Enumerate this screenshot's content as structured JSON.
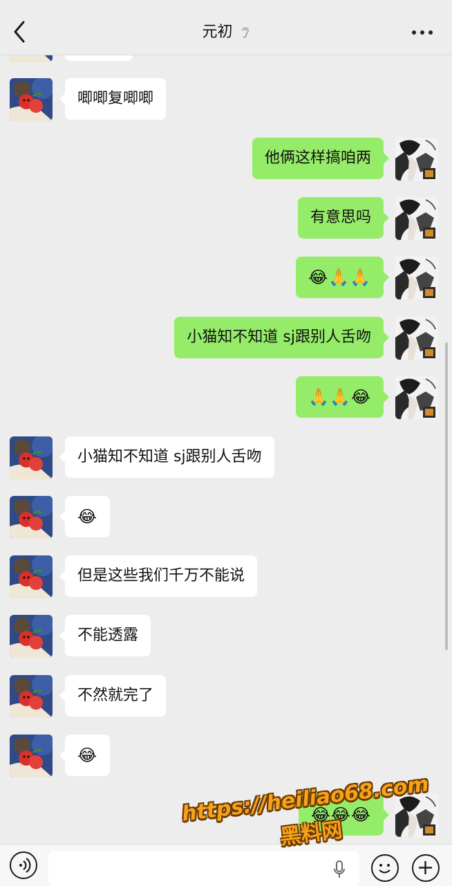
{
  "header": {
    "title": "元初",
    "back_icon": "chevron-left-icon",
    "mute_icon": "ear-muted-icon",
    "more_icon": "more-dots-icon"
  },
  "messages": [
    {
      "side": "left",
      "text": "",
      "partial": true
    },
    {
      "side": "left",
      "text": "唧唧复唧唧"
    },
    {
      "side": "right",
      "text": "他俩这样搞咱两"
    },
    {
      "side": "right",
      "text": "有意思吗"
    },
    {
      "side": "right",
      "text": "😂🙏🙏",
      "emoji": true
    },
    {
      "side": "right",
      "text": "小猫知不知道 sj跟别人舌吻"
    },
    {
      "side": "right",
      "text": "🙏🙏😂",
      "emoji": true
    },
    {
      "side": "left",
      "text": "小猫知不知道 sj跟别人舌吻"
    },
    {
      "side": "left",
      "text": "😂",
      "emoji": true
    },
    {
      "side": "left",
      "text": "但是这些我们千万不能说"
    },
    {
      "side": "left",
      "text": "不能透露"
    },
    {
      "side": "left",
      "text": "不然就完了"
    },
    {
      "side": "left",
      "text": "😂",
      "emoji": true
    },
    {
      "side": "right",
      "text": "😂😂😂",
      "emoji": true
    }
  ],
  "input_bar": {
    "voice_icon": "voice-icon",
    "mic_icon": "mic-icon",
    "emoji_icon": "emoji-icon",
    "plus_icon": "plus-icon",
    "input_value": ""
  },
  "watermark": {
    "url": "https://heiliao68.com",
    "cn": "黑料网"
  },
  "colors": {
    "background": "#ededed",
    "sent_bubble": "#95ec69",
    "received_bubble": "#ffffff"
  }
}
